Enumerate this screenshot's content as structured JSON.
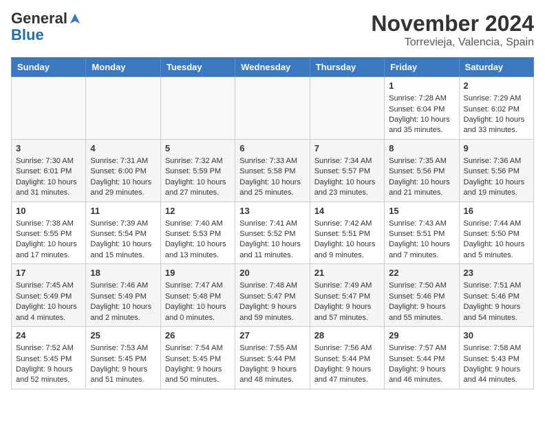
{
  "logo": {
    "general": "General",
    "blue": "Blue"
  },
  "title": "November 2024",
  "subtitle": "Torrevieja, Valencia, Spain",
  "days_of_week": [
    "Sunday",
    "Monday",
    "Tuesday",
    "Wednesday",
    "Thursday",
    "Friday",
    "Saturday"
  ],
  "weeks": [
    [
      {
        "day": "",
        "info": ""
      },
      {
        "day": "",
        "info": ""
      },
      {
        "day": "",
        "info": ""
      },
      {
        "day": "",
        "info": ""
      },
      {
        "day": "",
        "info": ""
      },
      {
        "day": "1",
        "info": "Sunrise: 7:28 AM\nSunset: 6:04 PM\nDaylight: 10 hours and 35 minutes."
      },
      {
        "day": "2",
        "info": "Sunrise: 7:29 AM\nSunset: 6:02 PM\nDaylight: 10 hours and 33 minutes."
      }
    ],
    [
      {
        "day": "3",
        "info": "Sunrise: 7:30 AM\nSunset: 6:01 PM\nDaylight: 10 hours and 31 minutes."
      },
      {
        "day": "4",
        "info": "Sunrise: 7:31 AM\nSunset: 6:00 PM\nDaylight: 10 hours and 29 minutes."
      },
      {
        "day": "5",
        "info": "Sunrise: 7:32 AM\nSunset: 5:59 PM\nDaylight: 10 hours and 27 minutes."
      },
      {
        "day": "6",
        "info": "Sunrise: 7:33 AM\nSunset: 5:58 PM\nDaylight: 10 hours and 25 minutes."
      },
      {
        "day": "7",
        "info": "Sunrise: 7:34 AM\nSunset: 5:57 PM\nDaylight: 10 hours and 23 minutes."
      },
      {
        "day": "8",
        "info": "Sunrise: 7:35 AM\nSunset: 5:56 PM\nDaylight: 10 hours and 21 minutes."
      },
      {
        "day": "9",
        "info": "Sunrise: 7:36 AM\nSunset: 5:56 PM\nDaylight: 10 hours and 19 minutes."
      }
    ],
    [
      {
        "day": "10",
        "info": "Sunrise: 7:38 AM\nSunset: 5:55 PM\nDaylight: 10 hours and 17 minutes."
      },
      {
        "day": "11",
        "info": "Sunrise: 7:39 AM\nSunset: 5:54 PM\nDaylight: 10 hours and 15 minutes."
      },
      {
        "day": "12",
        "info": "Sunrise: 7:40 AM\nSunset: 5:53 PM\nDaylight: 10 hours and 13 minutes."
      },
      {
        "day": "13",
        "info": "Sunrise: 7:41 AM\nSunset: 5:52 PM\nDaylight: 10 hours and 11 minutes."
      },
      {
        "day": "14",
        "info": "Sunrise: 7:42 AM\nSunset: 5:51 PM\nDaylight: 10 hours and 9 minutes."
      },
      {
        "day": "15",
        "info": "Sunrise: 7:43 AM\nSunset: 5:51 PM\nDaylight: 10 hours and 7 minutes."
      },
      {
        "day": "16",
        "info": "Sunrise: 7:44 AM\nSunset: 5:50 PM\nDaylight: 10 hours and 5 minutes."
      }
    ],
    [
      {
        "day": "17",
        "info": "Sunrise: 7:45 AM\nSunset: 5:49 PM\nDaylight: 10 hours and 4 minutes."
      },
      {
        "day": "18",
        "info": "Sunrise: 7:46 AM\nSunset: 5:49 PM\nDaylight: 10 hours and 2 minutes."
      },
      {
        "day": "19",
        "info": "Sunrise: 7:47 AM\nSunset: 5:48 PM\nDaylight: 10 hours and 0 minutes."
      },
      {
        "day": "20",
        "info": "Sunrise: 7:48 AM\nSunset: 5:47 PM\nDaylight: 9 hours and 59 minutes."
      },
      {
        "day": "21",
        "info": "Sunrise: 7:49 AM\nSunset: 5:47 PM\nDaylight: 9 hours and 57 minutes."
      },
      {
        "day": "22",
        "info": "Sunrise: 7:50 AM\nSunset: 5:46 PM\nDaylight: 9 hours and 55 minutes."
      },
      {
        "day": "23",
        "info": "Sunrise: 7:51 AM\nSunset: 5:46 PM\nDaylight: 9 hours and 54 minutes."
      }
    ],
    [
      {
        "day": "24",
        "info": "Sunrise: 7:52 AM\nSunset: 5:45 PM\nDaylight: 9 hours and 52 minutes."
      },
      {
        "day": "25",
        "info": "Sunrise: 7:53 AM\nSunset: 5:45 PM\nDaylight: 9 hours and 51 minutes."
      },
      {
        "day": "26",
        "info": "Sunrise: 7:54 AM\nSunset: 5:45 PM\nDaylight: 9 hours and 50 minutes."
      },
      {
        "day": "27",
        "info": "Sunrise: 7:55 AM\nSunset: 5:44 PM\nDaylight: 9 hours and 48 minutes."
      },
      {
        "day": "28",
        "info": "Sunrise: 7:56 AM\nSunset: 5:44 PM\nDaylight: 9 hours and 47 minutes."
      },
      {
        "day": "29",
        "info": "Sunrise: 7:57 AM\nSunset: 5:44 PM\nDaylight: 9 hours and 46 minutes."
      },
      {
        "day": "30",
        "info": "Sunrise: 7:58 AM\nSunset: 5:43 PM\nDaylight: 9 hours and 44 minutes."
      }
    ]
  ]
}
